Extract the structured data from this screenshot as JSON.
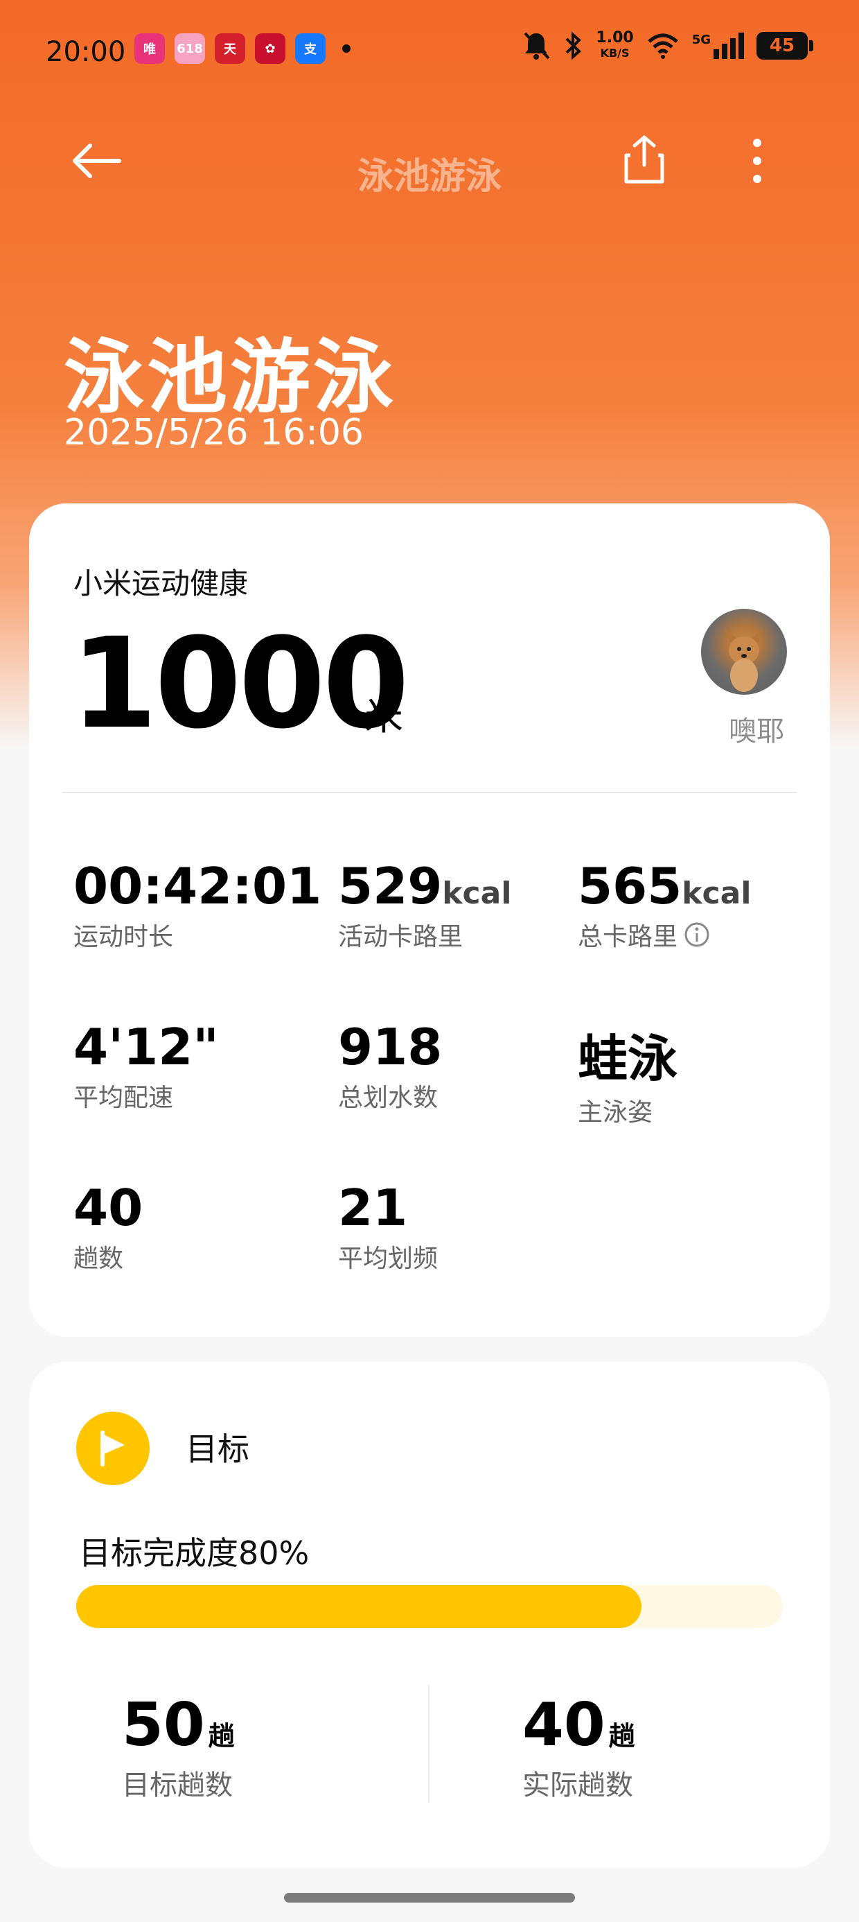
{
  "status_bar": {
    "time": "20:00",
    "net_speed_value": "1.00",
    "net_speed_unit": "KB/S",
    "network": "5G",
    "battery": "45"
  },
  "header": {
    "title": "泳池游泳"
  },
  "hero": {
    "title": "泳池游泳",
    "datetime": "2025/5/26 16:06"
  },
  "summary": {
    "source": "小米运动健康",
    "distance_value": "1000",
    "distance_unit": "米",
    "user_name": "噢耶",
    "metrics": [
      {
        "value": "00:42:01",
        "unit": "",
        "label": "运动时长"
      },
      {
        "value": "529",
        "unit": "kcal",
        "label": "活动卡路里"
      },
      {
        "value": "565",
        "unit": "kcal",
        "label": "总卡路里"
      },
      {
        "value": "4'12\"",
        "unit": "",
        "label": "平均配速"
      },
      {
        "value": "918",
        "unit": "",
        "label": "总划水数"
      },
      {
        "value": "蛙泳",
        "unit": "",
        "label": "主泳姿"
      },
      {
        "value": "40",
        "unit": "",
        "label": "趟数"
      },
      {
        "value": "21",
        "unit": "",
        "label": "平均划频"
      }
    ]
  },
  "goal": {
    "title": "目标",
    "progress_label": "目标完成度80%",
    "progress_fraction": 0.8,
    "target_value": "50",
    "target_unit": "趟",
    "target_label": "目标趟数",
    "actual_value": "40",
    "actual_unit": "趟",
    "actual_label": "实际趟数"
  },
  "colors": {
    "accent_orange": "#f36a28",
    "goal_yellow": "#ffc600"
  }
}
